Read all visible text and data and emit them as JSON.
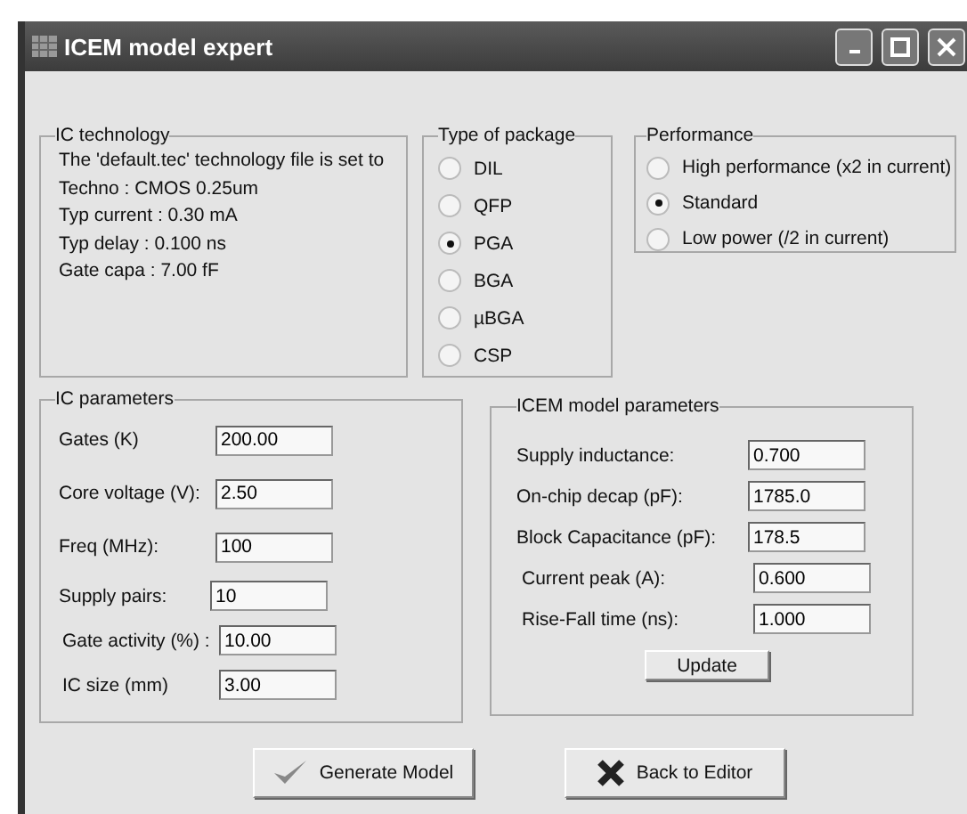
{
  "window": {
    "title": "ICEM model expert"
  },
  "ic_technology": {
    "title": "IC technology",
    "lines": [
      "The 'default.tec'  technology file is set to",
      "Techno : CMOS 0.25um",
      "Typ current : 0.30 mA",
      "Typ delay : 0.100 ns",
      "Gate capa : 7.00 fF"
    ]
  },
  "package": {
    "title": "Type of package",
    "options": [
      {
        "label": "DIL",
        "selected": false
      },
      {
        "label": "QFP",
        "selected": false
      },
      {
        "label": "PGA",
        "selected": true
      },
      {
        "label": "BGA",
        "selected": false
      },
      {
        "label": "µBGA",
        "selected": false
      },
      {
        "label": "CSP",
        "selected": false
      }
    ]
  },
  "performance": {
    "title": "Performance",
    "options": [
      {
        "label": "High performance (x2 in current)",
        "selected": false
      },
      {
        "label": "Standard",
        "selected": true
      },
      {
        "label": "Low power (/2 in current)",
        "selected": false
      }
    ]
  },
  "ic_parameters": {
    "title": "IC parameters",
    "fields": [
      {
        "label": "Gates (K)",
        "value": "200.00"
      },
      {
        "label": "Core voltage (V):",
        "value": "2.50"
      },
      {
        "label": "Freq (MHz):",
        "value": "100"
      },
      {
        "label": "Supply pairs:",
        "value": "10"
      },
      {
        "label": "Gate activity (%) :",
        "value": "10.00"
      },
      {
        "label": "IC size (mm)",
        "value": "3.00"
      }
    ]
  },
  "icem_parameters": {
    "title": "ICEM model parameters",
    "fields": [
      {
        "label": "Supply inductance:",
        "value": "0.700"
      },
      {
        "label": "On-chip decap (pF):",
        "value": "1785.0"
      },
      {
        "label": "Block Capacitance (pF):",
        "value": "178.5"
      },
      {
        "label": "Current peak (A):",
        "value": "0.600"
      },
      {
        "label": "Rise-Fall time (ns):",
        "value": "1.000"
      }
    ],
    "button": "Update"
  },
  "buttons": [
    {
      "kind": "check",
      "label": "Generate Model"
    },
    {
      "kind": "cross",
      "label": "Back to Editor"
    }
  ]
}
